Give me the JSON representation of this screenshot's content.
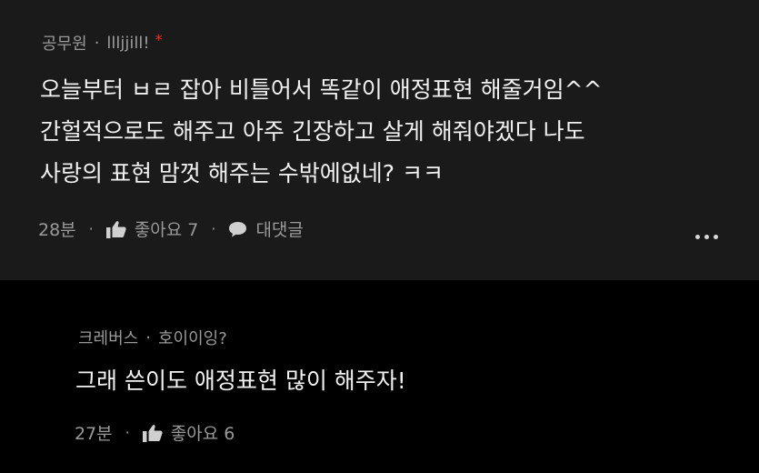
{
  "comment": {
    "author": "공무원",
    "nickname": "llljjill!",
    "badge": "*",
    "lines": [
      "오늘부터 ㅂㄹ 잡아 비틀어서 똑같이 애정표현 해줄거임^^",
      "간헐적으로도 해주고 아주 긴장하고 살게 해줘야겠다 나도",
      "사랑의 표현 맘껏 해주는 수밖에없네? ㅋㅋ"
    ],
    "time": "28분",
    "like_label": "좋아요 7",
    "reply_label": "대댓글",
    "more_icon": "more-dots-icon"
  },
  "reply": {
    "author": "크레버스",
    "nickname": "호이이잉?",
    "text": "그래 쓴이도 애정표현 많이 해주자!",
    "time": "27분",
    "like_label": "좋아요 6"
  },
  "separator": "·",
  "colors": {
    "comment_bg": "#1a1a1a",
    "reply_bg": "#000000",
    "meta_text": "#9a9a9a",
    "body_text": "#f2f2f2",
    "badge": "#e0342b"
  }
}
